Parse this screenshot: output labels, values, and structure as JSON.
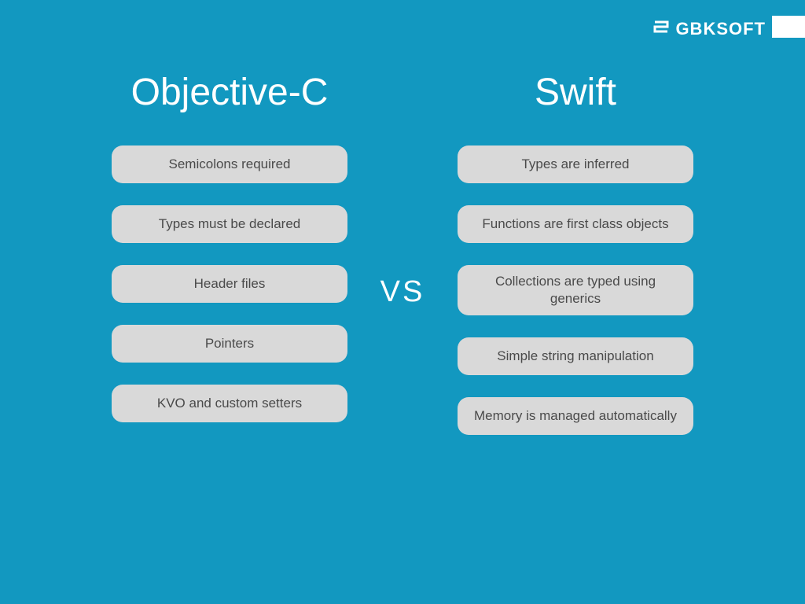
{
  "brand": {
    "name": "GBKSOFT"
  },
  "left": {
    "title": "Objective-C",
    "items": [
      "Semicolons required",
      "Types must be declared",
      "Header files",
      "Pointers",
      "KVO and custom setters"
    ]
  },
  "divider": {
    "text": "VS"
  },
  "right": {
    "title": "Swift",
    "items": [
      "Types are inferred",
      "Functions are first class objects",
      "Collections are typed using generics",
      "Simple string manipulation",
      "Memory is managed automatically"
    ]
  }
}
